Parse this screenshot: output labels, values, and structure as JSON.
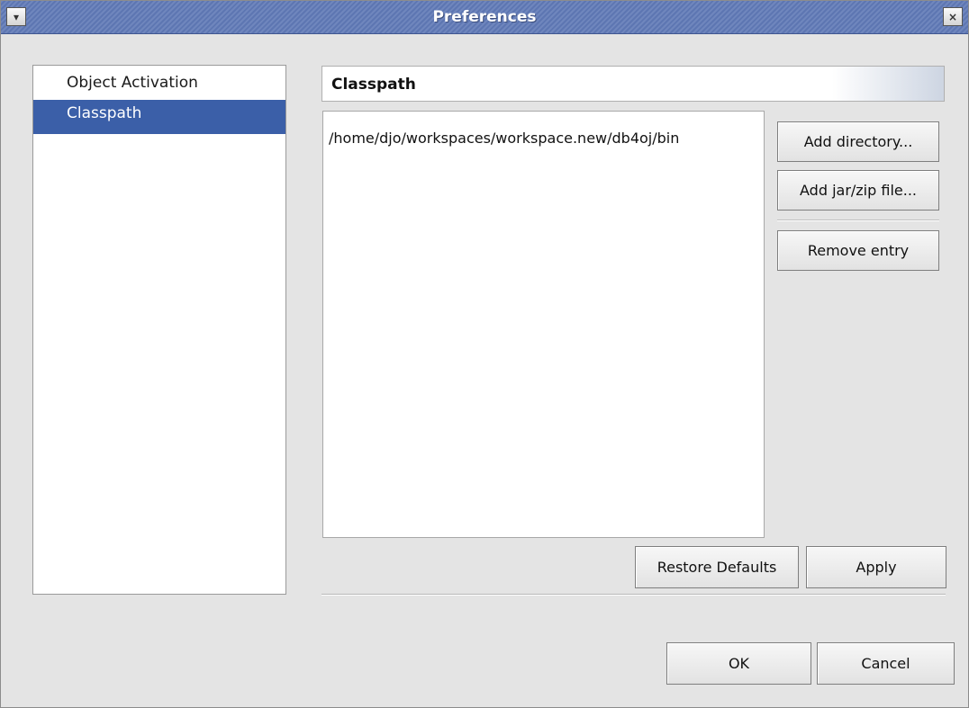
{
  "window": {
    "title": "Preferences",
    "menu_icon": "▾",
    "close_icon": "×"
  },
  "nav": {
    "items": [
      {
        "label": "Object Activation",
        "selected": false
      },
      {
        "label": "Classpath",
        "selected": true
      }
    ]
  },
  "page": {
    "header": "Classpath",
    "entries": [
      "/home/djo/workspaces/workspace.new/db4oj/bin"
    ]
  },
  "buttons": {
    "add_directory": "Add directory...",
    "add_jar_zip": "Add jar/zip file...",
    "remove_entry": "Remove entry",
    "restore_defaults": "Restore Defaults",
    "apply": "Apply",
    "ok": "OK",
    "cancel": "Cancel"
  },
  "colors": {
    "titlebar": "#5d76b2",
    "selection": "#3b5fa8"
  }
}
